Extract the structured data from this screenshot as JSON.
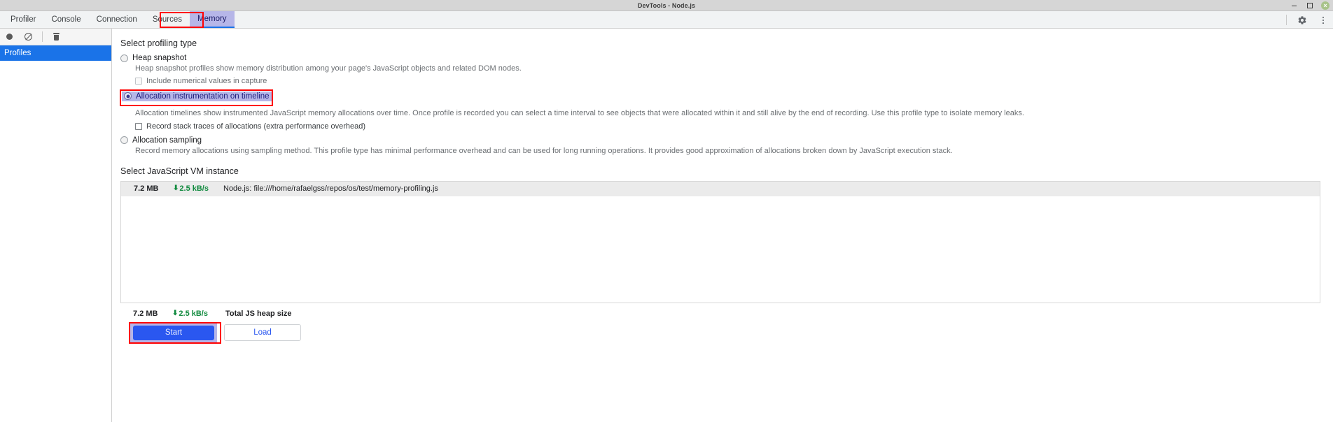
{
  "window": {
    "title": "DevTools - Node.js",
    "controls": [
      {
        "name": "minimize-button",
        "glyph": ""
      },
      {
        "name": "maximize-button",
        "glyph": ""
      },
      {
        "name": "close-button",
        "glyph": "×"
      }
    ]
  },
  "tabbar": {
    "tabs": [
      {
        "label": "Profiler",
        "selected": false
      },
      {
        "label": "Console",
        "selected": false
      },
      {
        "label": "Connection",
        "selected": false
      },
      {
        "label": "Sources",
        "selected": false
      },
      {
        "label": "Memory",
        "selected": true
      }
    ],
    "settings_icon": "gear-icon",
    "more_icon": "kebab-menu-icon"
  },
  "sidebar": {
    "toolbar": [
      {
        "name": "record-button",
        "icon": "record-circle-icon"
      },
      {
        "name": "clear-button",
        "icon": "no-entry-icon"
      },
      {
        "name": "delete-button",
        "icon": "trash-icon"
      }
    ],
    "items": [
      {
        "label": "Profiles",
        "selected": true
      }
    ]
  },
  "main": {
    "profiling_section_title": "Select profiling type",
    "options": [
      {
        "label": "Heap snapshot",
        "selected": false,
        "highlighted": false,
        "description": "Heap snapshot profiles show memory distribution among your page's JavaScript objects and related DOM nodes.",
        "checkbox": {
          "label": "Include numerical values in capture",
          "checked": false,
          "enabled": false
        }
      },
      {
        "label": "Allocation instrumentation on timeline",
        "selected": true,
        "highlighted": true,
        "description": "Allocation timelines show instrumented JavaScript memory allocations over time. Once profile is recorded you can select a time interval to see objects that were allocated within it and still alive by the end of recording. Use this profile type to isolate memory leaks.",
        "checkbox": {
          "label": "Record stack traces of allocations (extra performance overhead)",
          "checked": false,
          "enabled": true
        }
      },
      {
        "label": "Allocation sampling",
        "selected": false,
        "highlighted": false,
        "description": "Record memory allocations using sampling method. This profile type has minimal performance overhead and can be used for long running operations. It provides good approximation of allocations broken down by JavaScript execution stack.",
        "checkbox": null
      }
    ],
    "vm_section_title": "Select JavaScript VM instance",
    "vm_rows": [
      {
        "size": "7.2 MB",
        "rate": "2.5 kB/s",
        "rate_arrow": "⬇",
        "path": "Node.js: file:///home/rafaelgss/repos/os/test/memory-profiling.js"
      }
    ],
    "totals": {
      "size": "7.2 MB",
      "rate": "2.5 kB/s",
      "rate_arrow": "⬇",
      "label": "Total JS heap size"
    },
    "buttons": {
      "start": "Start",
      "load": "Load"
    }
  },
  "colors": {
    "accent_blue": "#2a57f0",
    "selection_blue": "#1a73e8",
    "highlight_lavender": "#b6b6e8",
    "annotation_red": "#ff0000",
    "rate_green": "#108a3e"
  }
}
